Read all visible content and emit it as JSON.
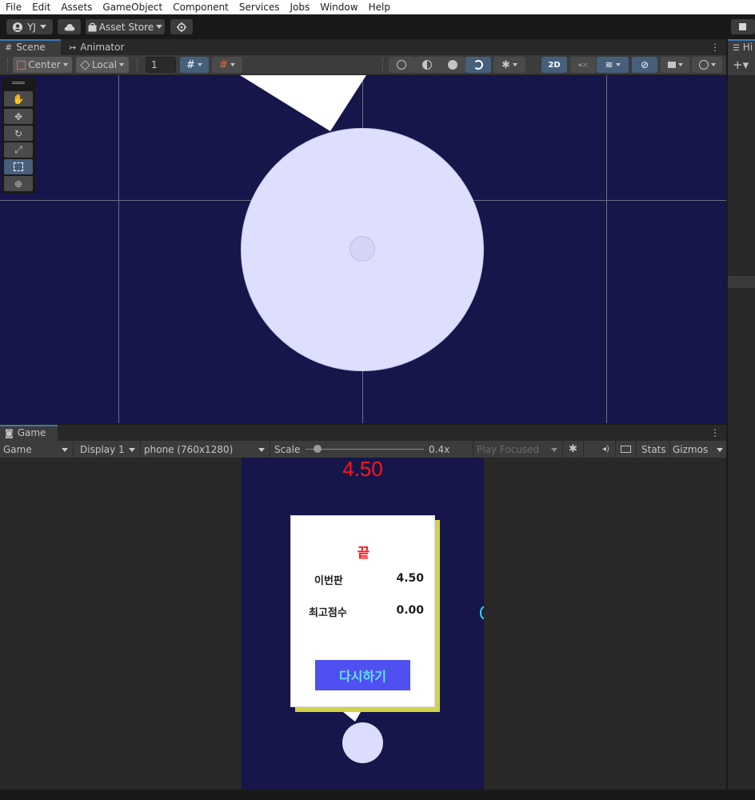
{
  "menu": [
    "File",
    "Edit",
    "Assets",
    "GameObject",
    "Component",
    "Services",
    "Jobs",
    "Window",
    "Help"
  ],
  "toolbar": {
    "account_label": "YJ",
    "cloud_icon": "cloud-icon",
    "asset_store_label": "Asset Store",
    "settings_icon": "gear-icon"
  },
  "scene_panel": {
    "tabs": [
      {
        "label": "Scene",
        "icon": "grid-icon",
        "active": true
      },
      {
        "label": "Animator",
        "icon": "animator-icon",
        "active": false
      }
    ],
    "pivot_label": "Center",
    "space_label": "Local",
    "grid_size_value": "1",
    "mode_2d_label": "2D",
    "tools": [
      "view-hand",
      "move",
      "rotate",
      "scale",
      "rect",
      "transform"
    ],
    "active_tool": "rect"
  },
  "game_panel": {
    "tab_label": "Game",
    "view_label": "Game",
    "display_label": "Display 1",
    "resolution_label": "phone (760x1280)",
    "scale_label": "Scale",
    "scale_value": "0.4x",
    "scale_fraction": 0.1,
    "play_mode_label": "Play Focused",
    "stats_label": "Stats",
    "gizmos_label": "Gizmos"
  },
  "game": {
    "current_score_top": "4.50",
    "result_title": "끝",
    "this_round_label": "이번판",
    "this_round_value": "4.50",
    "best_score_label": "최고점수",
    "best_score_value": "0.00",
    "retry_label": "다시하기"
  },
  "right_panel": {
    "tab_label": "Hi",
    "add_label": "+▾"
  },
  "colors": {
    "scene_background": "#16164b",
    "circle_fill": "#dedefe",
    "score_red": "#ff1616",
    "retry_button": "#5050f0",
    "retry_text": "#64e0ff",
    "card_shadow": "#d2d24a",
    "accent_blue": "#3a79bb"
  }
}
